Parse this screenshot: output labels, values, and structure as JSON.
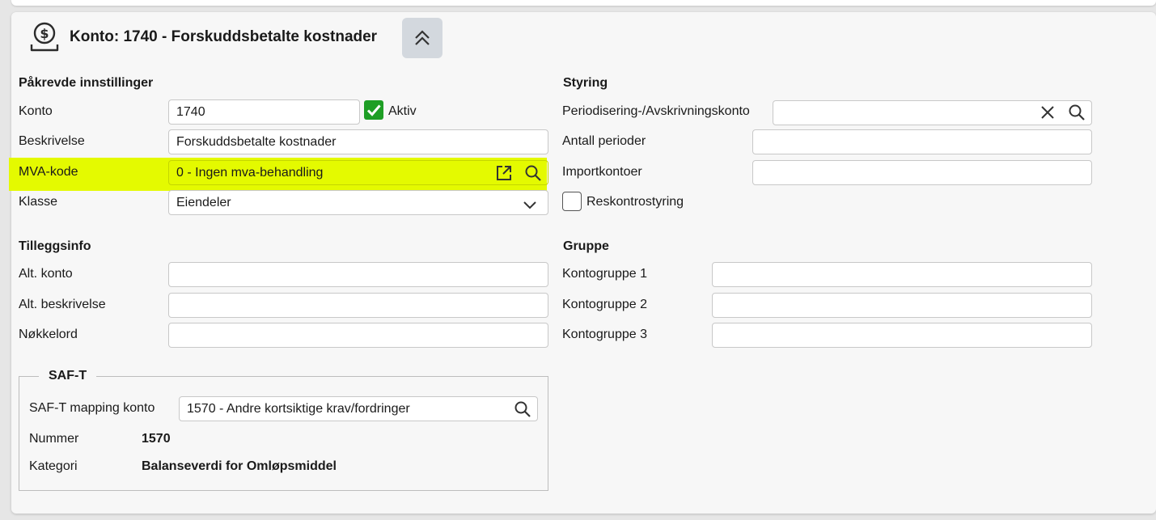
{
  "header": {
    "title": "Konto: 1740 - Forskuddsbetalte kostnader",
    "icon": "money-icon",
    "collapse_icon": "double-chevron-up-icon"
  },
  "required": {
    "section_title": "Påkrevde innstillinger",
    "konto_label": "Konto",
    "konto_value": "1740",
    "aktiv_label": "Aktiv",
    "aktiv_checked": true,
    "beskrivelse_label": "Beskrivelse",
    "beskrivelse_value": "Forskuddsbetalte kostnader",
    "mva_label": "MVA-kode",
    "mva_value": "0 - Ingen mva-behandling",
    "klasse_label": "Klasse",
    "klasse_value": "Eiendeler"
  },
  "control": {
    "section_title": "Styring",
    "periodisering_label": "Periodisering-/Avskrivningskonto",
    "periodisering_value": "",
    "antall_perioder_label": "Antall perioder",
    "antall_perioder_value": "",
    "importkontoer_label": "Importkontoer",
    "importkontoer_value": "",
    "reskontro_label": "Reskontrostyring",
    "reskontro_checked": false
  },
  "extra": {
    "section_title": "Tilleggsinfo",
    "alt_konto_label": "Alt. konto",
    "alt_konto_value": "",
    "alt_beskrivelse_label": "Alt. beskrivelse",
    "alt_beskrivelse_value": "",
    "nokkelord_label": "Nøkkelord",
    "nokkelord_value": ""
  },
  "group": {
    "section_title": "Gruppe",
    "kontogruppe1_label": "Kontogruppe 1",
    "kontogruppe1_value": "",
    "kontogruppe2_label": "Kontogruppe 2",
    "kontogruppe2_value": "",
    "kontogruppe3_label": "Kontogruppe 3",
    "kontogruppe3_value": ""
  },
  "saft": {
    "legend": "SAF-T",
    "mapping_label": "SAF-T mapping konto",
    "mapping_value": "1570 - Andre kortsiktige krav/fordringer",
    "nummer_label": "Nummer",
    "nummer_value": "1570",
    "kategori_label": "Kategori",
    "kategori_value": "Balanseverdi for Omløpsmiddel"
  },
  "colors": {
    "highlight": "#e4fa00",
    "checkbox_checked": "#1e9e25",
    "collapse_button_bg": "#d3d8de"
  }
}
